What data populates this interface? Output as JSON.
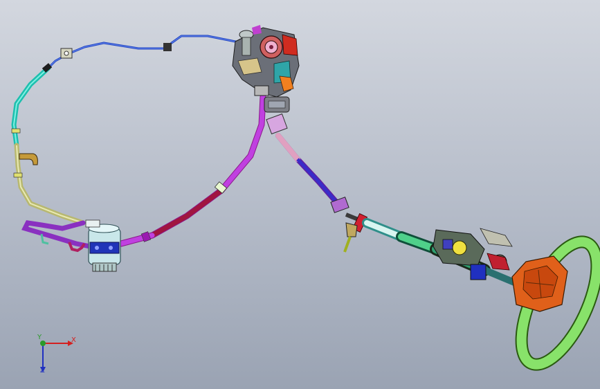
{
  "view": {
    "background_top": "#d3d7df",
    "background_bottom": "#9aa3b3"
  },
  "model": {
    "components": [
      "pressure-hose",
      "return-hose",
      "steering-pump",
      "steering-gear",
      "intermediate-shaft",
      "steering-column",
      "steering-wheel"
    ]
  },
  "triad": {
    "x_label": "X",
    "y_label": "Y",
    "z_label": "Z",
    "x_color": "#d42020",
    "y_color": "#2a9a2a",
    "z_color": "#2030c0"
  }
}
